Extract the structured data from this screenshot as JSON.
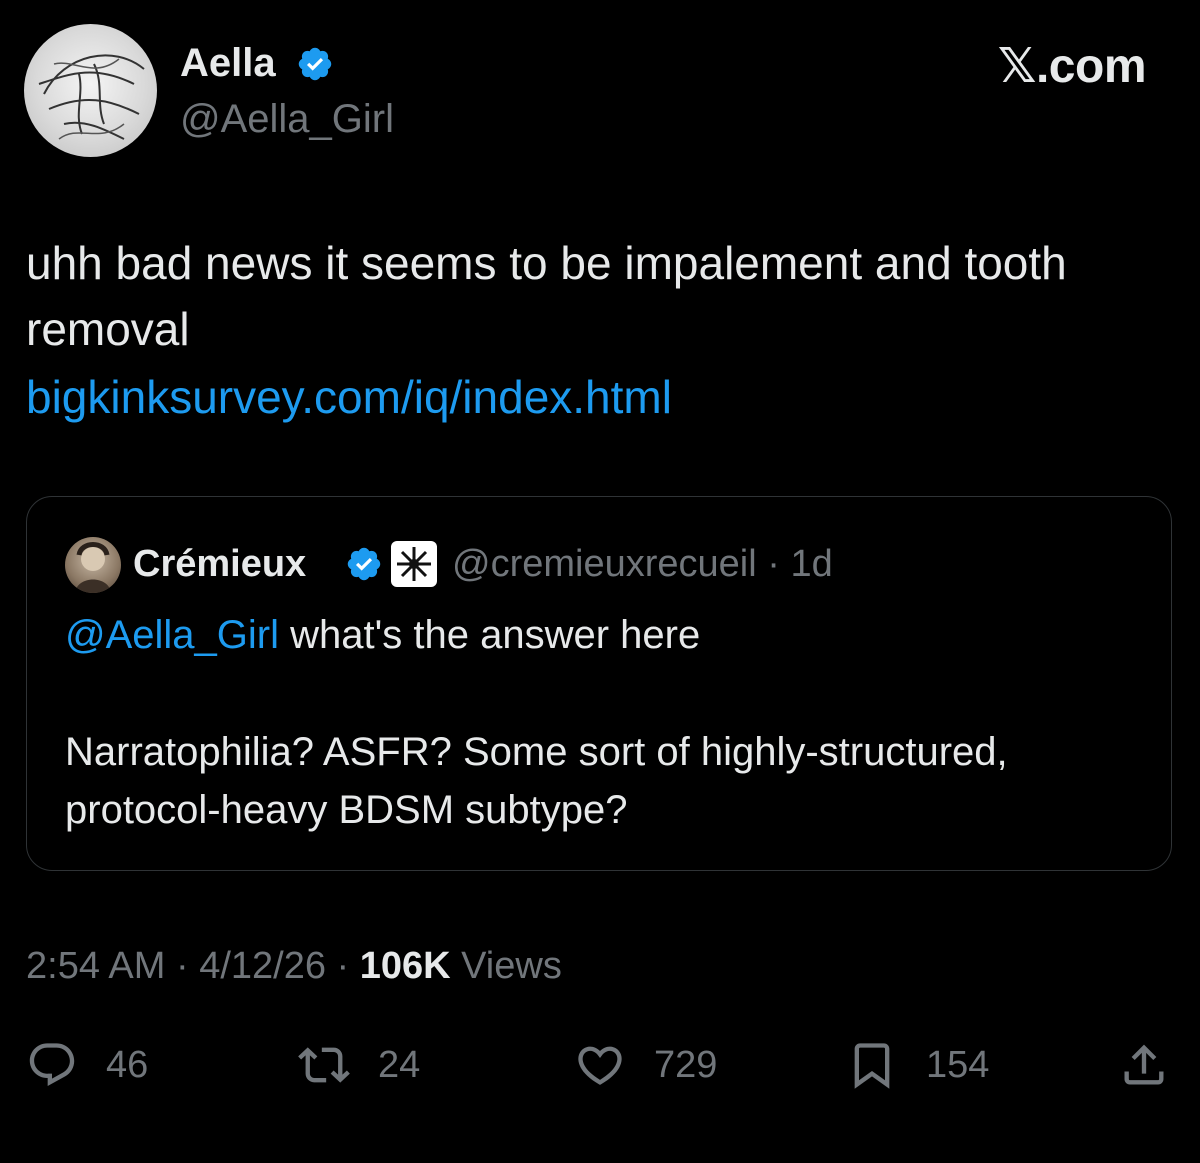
{
  "header": {
    "author_name": "Aella",
    "author_handle": "@Aella_Girl",
    "brand": "𝕏.com"
  },
  "tweet": {
    "text": "uhh bad news it seems to be impalement and tooth removal",
    "link": "bigkinksurvey.com/iq/index.html"
  },
  "quote": {
    "name": "Crémieux",
    "handle_time": "@cremieuxrecueil · 1d",
    "mention": "@Aella_Girl",
    "line1_rest": " what's the answer here",
    "body": "Narratophilia? ASFR? Some sort of highly-structured, protocol-heavy BDSM subtype?"
  },
  "meta": {
    "time_date": "2:54 AM · 4/12/26 · ",
    "views_count": "106K",
    "views_label": " Views"
  },
  "actions": {
    "replies": "46",
    "reposts": "24",
    "likes": "729",
    "bookmarks": "154"
  },
  "colors": {
    "background": "#000000",
    "text": "#e7e9ea",
    "secondary": "#71767b",
    "link": "#1d9bf0",
    "border": "#2f3336"
  },
  "icons": [
    "verified-badge-icon",
    "reply-icon",
    "repost-icon",
    "like-icon",
    "bookmark-icon",
    "share-icon"
  ]
}
